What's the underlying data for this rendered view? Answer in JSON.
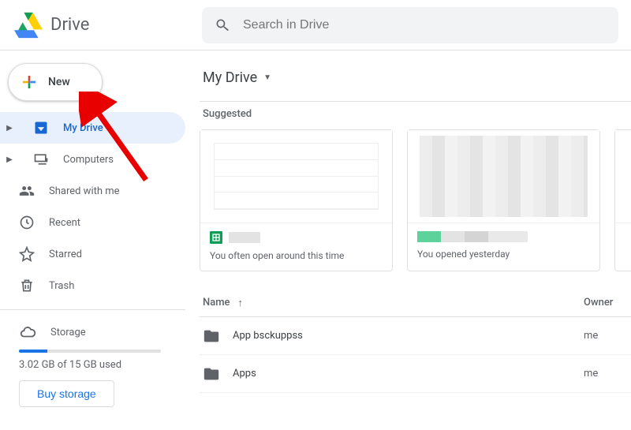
{
  "app": {
    "name": "Drive"
  },
  "search": {
    "placeholder": "Search in Drive"
  },
  "new_button": {
    "label": "New"
  },
  "sidebar": {
    "tree": [
      {
        "label": "My Drive",
        "active": true
      },
      {
        "label": "Computers",
        "active": false
      }
    ],
    "items": [
      {
        "label": "Shared with me"
      },
      {
        "label": "Recent"
      },
      {
        "label": "Starred"
      },
      {
        "label": "Trash"
      }
    ]
  },
  "storage": {
    "label": "Storage",
    "used_text": "3.02 GB of 15 GB used",
    "percent": 20,
    "buy_label": "Buy storage"
  },
  "main": {
    "page_title": "My Drive",
    "suggested_label": "Suggested",
    "suggested": [
      {
        "caption": "You often open around this time",
        "doc_type": "sheets"
      },
      {
        "caption": "You opened yesterday",
        "doc_type": "generic"
      }
    ],
    "table": {
      "col_name": "Name",
      "col_owner": "Owner",
      "rows": [
        {
          "name": "App bsckuppss",
          "owner": "me"
        },
        {
          "name": "Apps",
          "owner": "me"
        }
      ]
    }
  }
}
